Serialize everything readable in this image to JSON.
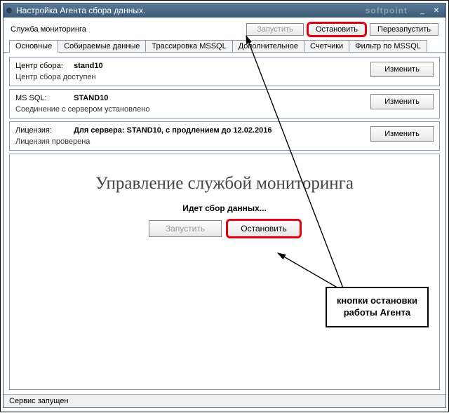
{
  "window": {
    "title": "Настройка Агента сбора данных.",
    "watermark": "softpoint",
    "minimize": "_",
    "close": "✕"
  },
  "service": {
    "label": "Служба мониторинга",
    "start": "Запустить",
    "stop": "Остановить",
    "restart": "Перезапустить"
  },
  "tabs": [
    {
      "label": "Основные"
    },
    {
      "label": "Собираемые данные"
    },
    {
      "label": "Трассировка MSSQL"
    },
    {
      "label": "Дополнительное"
    },
    {
      "label": "Счетчики"
    },
    {
      "label": "Фильтр по MSSQL"
    }
  ],
  "panels": {
    "center": {
      "label": "Центр сбора:",
      "value": "stand10",
      "status": "Центр сбора доступен",
      "change": "Изменить"
    },
    "mssql": {
      "label": "MS SQL:",
      "value": "STAND10",
      "status": "Соединение с сервером установлено",
      "change": "Изменить"
    },
    "license": {
      "label": "Лицензия:",
      "value": "Для сервера: STAND10, с продлением до 12.02.2016",
      "status": "Лицензия проверена",
      "change": "Изменить"
    }
  },
  "management": {
    "title": "Управление службой мониторинга",
    "status": "Идет сбор данных...",
    "start": "Запустить",
    "stop": "Остановить"
  },
  "statusbar": {
    "text": "Сервис запущен"
  },
  "annotation": {
    "line1": "кнопки остановки",
    "line2": "работы Агента"
  }
}
